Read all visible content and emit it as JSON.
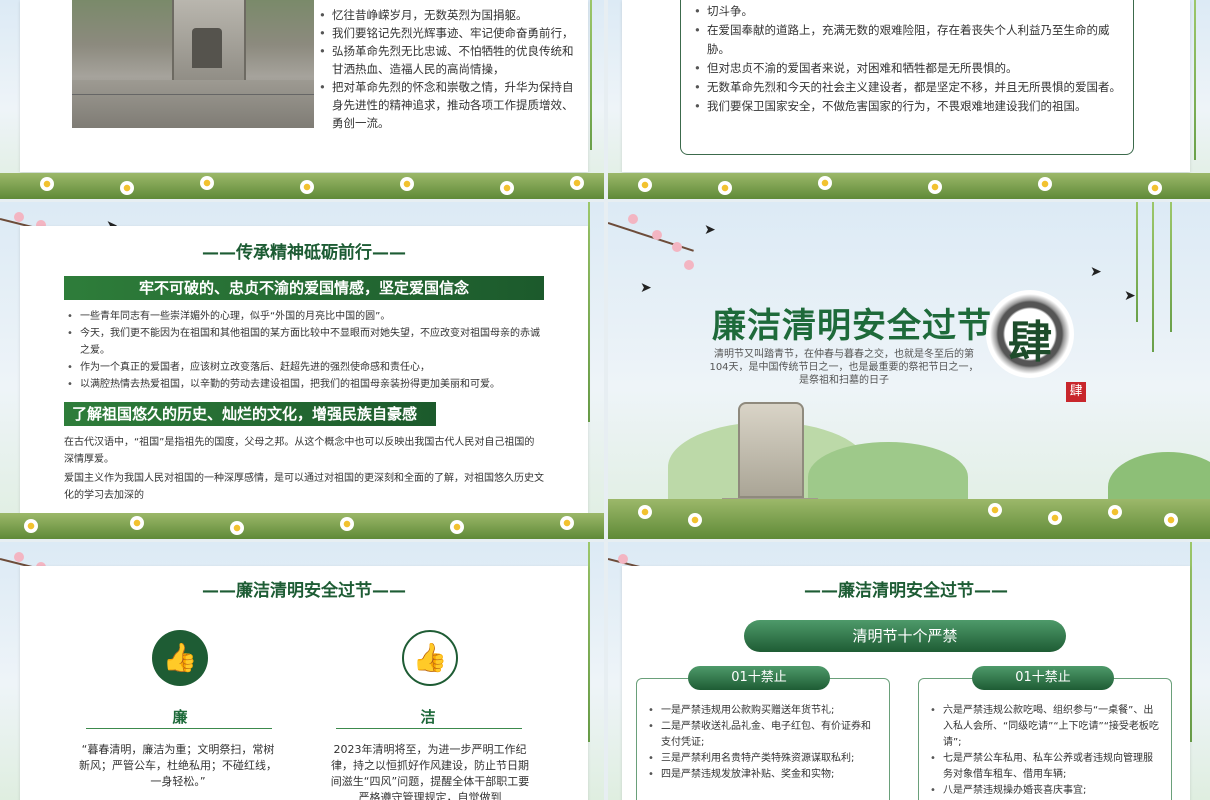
{
  "slide1": {
    "bullets": [
      "忆往昔峥嵘岁月，无数英烈为国捐躯。",
      "我们要铭记先烈光辉事迹、牢记使命奋勇前行，",
      "弘扬革命先烈无比忠诚、不怕牺牲的优良传统和甘洒热血、造福人民的高尚情操，",
      "把对革命先烈的怀念和崇敬之情，升华为保持自身先进性的精神追求，推动各项工作提质增效、勇创一流。"
    ]
  },
  "slide2": {
    "bullets": [
      "切斗争。",
      "在爱国奉献的道路上，充满无数的艰难险阻，存在着丧失个人利益乃至生命的威胁。",
      "但对忠贞不渝的爱国者来说，对困难和牺牲都是无所畏惧的。",
      "无数革命先烈和今天的社会主义建设者，都是坚定不移，并且无所畏惧的爱国者。",
      "我们要保卫国家安全，不做危害国家的行为，不畏艰难地建设我们的祖国。"
    ]
  },
  "slide3": {
    "heading": "——传承精神砥砺前行——",
    "bar1": "牢不可破的、忠贞不渝的爱国情感，坚定爱国信念",
    "bullets": [
      "一些青年同志有一些崇洋媚外的心理，似乎“外国的月亮比中国的圆”。",
      "今天，我们更不能因为在祖国和其他祖国的某方面比较中不显眼而对她失望，不应改变对祖国母亲的赤诚之爱。",
      "作为一个真正的爱国者，应该树立改变落后、赶超先进的强烈使命感和责任心，",
      "以满腔热情去热爱祖国，以辛勤的劳动去建设祖国，把我们的祖国母亲装扮得更加美丽和可爱。"
    ],
    "bar2": "了解祖国悠久的历史、灿烂的文化，增强民族自豪感",
    "para1": "在古代汉语中，“祖国”是指祖先的国度，父母之邦。从这个概念中也可以反映出我国古代人民对自己祖国的深情厚爱。",
    "para2": "爱国主义作为我国人民对祖国的一种深厚感情，是可以通过对祖国的更深刻和全面的了解，对祖国悠久历史文化的学习去加深的"
  },
  "slide4": {
    "title": "廉洁清明安全过节",
    "char": "肆",
    "seal": "肆",
    "desc": "清明节又叫踏青节，在仲春与暮春之交，也就是冬至后的第104天，是中国传统节日之一，也是最重要的祭祀节日之一，是祭祖和扫墓的日子"
  },
  "slide5": {
    "heading": "——廉洁清明安全过节——",
    "left": {
      "label": "廉",
      "text": "“暮春清明，廉洁为重；文明祭扫，常树新风；严管公车，杜绝私用；不碰红线，一身轻松。”"
    },
    "right": {
      "label": "洁",
      "text": "2023年清明将至，为进一步严明工作纪律，持之以恒抓好作风建设，防止节日期间滋生“四风”问题，提醒全体干部职工要严格遵守管理规定，自觉做到"
    }
  },
  "slide6": {
    "heading": "——廉洁清明安全过节——",
    "pill_main": "清明节十个严禁",
    "left": {
      "tag": "01十禁止",
      "items": [
        "一是严禁违规用公款购买赠送年货节礼;",
        "二是严禁收送礼品礼金、电子红包、有价证券和支付凭证;",
        "三是严禁利用名贵特产类特殊资源谋取私利;",
        "四是严禁违规发放津补贴、奖金和实物;"
      ]
    },
    "right": {
      "tag": "01十禁止",
      "items": [
        "六是严禁违规公款吃喝、组织参与“一桌餐”、出入私人会所、“同级吃请”“上下吃请”“接受老板吃请”;",
        "七是严禁公车私用、私车公养或者违规向管理服务对象借车租车、借用车辆;",
        "八是严禁违规操办婚丧喜庆事宜;"
      ]
    }
  },
  "colors": {
    "brand_green": "#1e6a3a",
    "accent_dark": "#1c5a2c"
  },
  "icons": {
    "thumb": "thumbs-up-icon"
  }
}
